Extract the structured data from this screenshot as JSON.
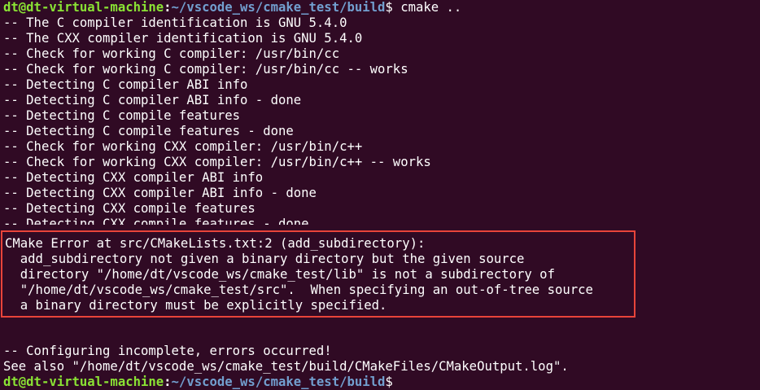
{
  "prompt": {
    "user_host": "dt@dt-virtual-machine",
    "colon": ":",
    "path": "~/vscode_ws/cmake_test/build",
    "symbol": "$",
    "command": " cmake .."
  },
  "output_lines": [
    "-- The C compiler identification is GNU 5.4.0",
    "-- The CXX compiler identification is GNU 5.4.0",
    "-- Check for working C compiler: /usr/bin/cc",
    "-- Check for working C compiler: /usr/bin/cc -- works",
    "-- Detecting C compiler ABI info",
    "-- Detecting C compiler ABI info - done",
    "-- Detecting C compile features",
    "-- Detecting C compile features - done",
    "-- Check for working CXX compiler: /usr/bin/c++",
    "-- Check for working CXX compiler: /usr/bin/c++ -- works",
    "-- Detecting CXX compiler ABI info",
    "-- Detecting CXX compiler ABI info - done",
    "-- Detecting CXX compile features",
    "-- Detecting CXX compile features - done"
  ],
  "error": {
    "lines": [
      "CMake Error at src/CMakeLists.txt:2 (add_subdirectory):",
      "  add_subdirectory not given a binary directory but the given source",
      "  directory \"/home/dt/vscode_ws/cmake_test/lib\" is not a subdirectory of",
      "  \"/home/dt/vscode_ws/cmake_test/src\".  When specifying an out-of-tree source",
      "  a binary directory must be explicitly specified."
    ],
    "highlight_color": "#e8443a"
  },
  "footer_lines": [
    "-- Configuring incomplete, errors occurred!",
    "See also \"/home/dt/vscode_ws/cmake_test/build/CMakeFiles/CMakeOutput.log\"."
  ],
  "colors": {
    "background": "#300a24",
    "prompt_user": "#8ae234",
    "prompt_path": "#729fcf",
    "text": "#ffffff"
  }
}
